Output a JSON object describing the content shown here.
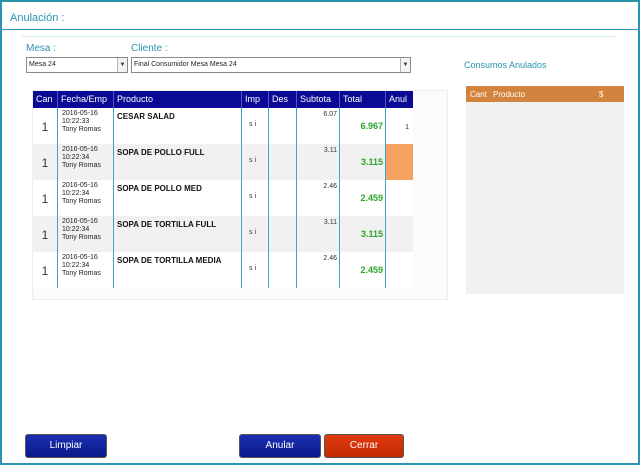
{
  "window": {
    "title": "Anulación :"
  },
  "mesa": {
    "label": "Mesa :",
    "value": "Mesa 24"
  },
  "cliente": {
    "label": "Cliente :",
    "value": "Final Consumidor Mesa Mesa 24"
  },
  "grid": {
    "headers": [
      "Can",
      "Fecha/Emp",
      "Producto",
      "Imp",
      "Des",
      "Subtota",
      "Total",
      "Anul"
    ],
    "rows": [
      {
        "can": "1",
        "fecha": "2016-05-16",
        "hora": "10:22:33",
        "emp": "Tony Romas",
        "producto": "CESAR SALAD",
        "imp": "s i",
        "des": "",
        "subtotal": "6.07",
        "total": "6.967",
        "anul": "1",
        "highlight": false
      },
      {
        "can": "1",
        "fecha": "2016-05-16",
        "hora": "10:22:34",
        "emp": "Tony Romas",
        "producto": "SOPA DE POLLO FULL",
        "imp": "s i",
        "des": "",
        "subtotal": "3.11",
        "total": "3.115",
        "anul": "",
        "highlight": true
      },
      {
        "can": "1",
        "fecha": "2016-05-16",
        "hora": "10:22:34",
        "emp": "Tony Romas",
        "producto": "SOPA DE POLLO MED",
        "imp": "s i",
        "des": "",
        "subtotal": "2.46",
        "total": "2.459",
        "anul": "",
        "highlight": false
      },
      {
        "can": "1",
        "fecha": "2016-05-16",
        "hora": "10:22:34",
        "emp": "Tony Romas",
        "producto": "SOPA DE TORTILLA FULL",
        "imp": "s i",
        "des": "",
        "subtotal": "3.11",
        "total": "3.115",
        "anul": "",
        "highlight": false
      },
      {
        "can": "1",
        "fecha": "2016-05-16",
        "hora": "10:22:34",
        "emp": "Tony Romas",
        "producto": "SOPA DE TORTILLA MEDIA",
        "imp": "s i",
        "des": "",
        "subtotal": "2.46",
        "total": "2.459",
        "anul": "",
        "highlight": false
      }
    ]
  },
  "consumos": {
    "title": "Consumos Anulados",
    "headers": [
      "Cant",
      "Producto",
      "$"
    ]
  },
  "buttons": {
    "limpiar": "Limpiar",
    "anular": "Anular",
    "cerrar": "Cerrar"
  },
  "colors": {
    "accent": "#2a94ae",
    "header": "#0a0a94",
    "total": "#2aa52a",
    "highlight": "#f4a260",
    "orange": "#d2843e",
    "cerrar": "#d43200"
  }
}
